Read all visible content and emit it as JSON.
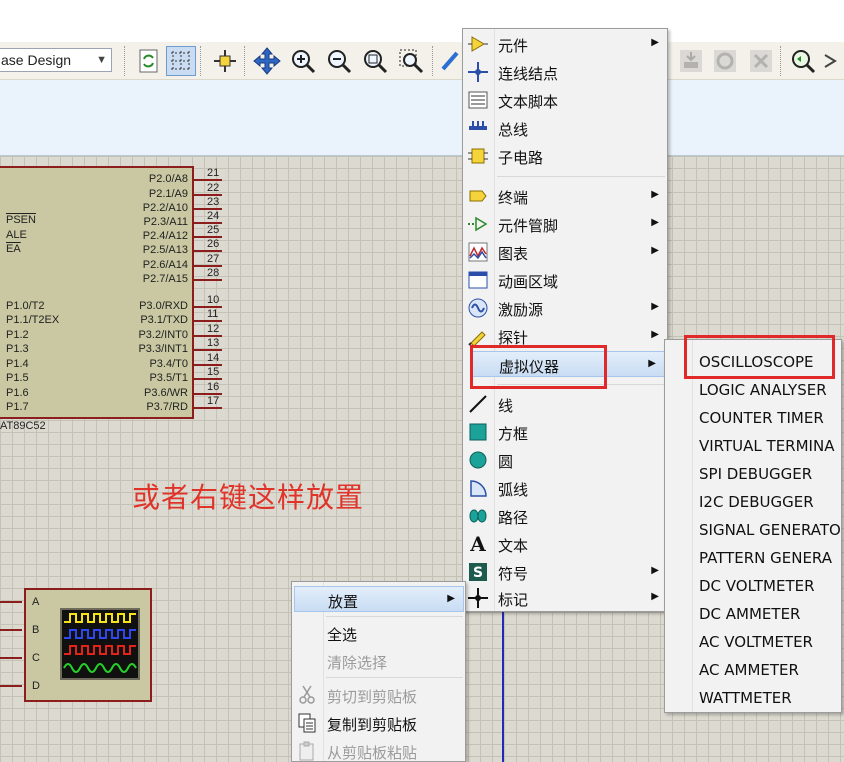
{
  "toolbar": {
    "design_mode": "ase Design",
    "icons": [
      "refresh-icon",
      "grid-icon",
      "origin-icon",
      "pan-icon",
      "zoom-in-icon",
      "zoom-out-icon",
      "zoom-all-icon",
      "zoom-area-icon",
      "wire-icon",
      "stack-icon",
      "undo-icon",
      "close-icon",
      "probe-icon",
      "forward-icon"
    ]
  },
  "chip": {
    "name": "AT89C52",
    "left_pins": [
      "PSEN",
      "ALE",
      "EA",
      "P1.0/T2",
      "P1.1/T2EX",
      "P1.2",
      "P1.3",
      "P1.4",
      "P1.5",
      "P1.6",
      "P1.7"
    ],
    "right_pins": [
      {
        "label": "P2.0/A8",
        "num": "21"
      },
      {
        "label": "P2.1/A9",
        "num": "22"
      },
      {
        "label": "P2.2/A10",
        "num": "23"
      },
      {
        "label": "P2.3/A11",
        "num": "24"
      },
      {
        "label": "P2.4/A12",
        "num": "25"
      },
      {
        "label": "P2.5/A13",
        "num": "26"
      },
      {
        "label": "P2.6/A14",
        "num": "27"
      },
      {
        "label": "P2.7/A15",
        "num": "28"
      },
      {
        "label": "P3.0/RXD",
        "num": "10"
      },
      {
        "label": "P3.1/TXD",
        "num": "11"
      },
      {
        "label": "P3.2/INT0",
        "num": "12"
      },
      {
        "label": "P3.3/INT1",
        "num": "13"
      },
      {
        "label": "P3.4/T0",
        "num": "14"
      },
      {
        "label": "P3.5/T1",
        "num": "15"
      },
      {
        "label": "P3.6/WR",
        "num": "16"
      },
      {
        "label": "P3.7/RD",
        "num": "17"
      }
    ]
  },
  "caption": "或者右键这样放置",
  "scope": {
    "channels": [
      "A",
      "B",
      "C",
      "D"
    ]
  },
  "main_menu": {
    "items": [
      {
        "label": "元件",
        "submenu": true
      },
      {
        "label": "连线结点",
        "submenu": false
      },
      {
        "label": "文本脚本",
        "submenu": false
      },
      {
        "label": "总线",
        "submenu": false
      },
      {
        "label": "子电路",
        "submenu": false
      },
      {
        "label": "终端",
        "submenu": true
      },
      {
        "label": "元件管脚",
        "submenu": true
      },
      {
        "label": "图表",
        "submenu": true
      },
      {
        "label": "动画区域",
        "submenu": false
      },
      {
        "label": "激励源",
        "submenu": true
      },
      {
        "label": "探针",
        "submenu": true
      },
      {
        "label": "虚拟仪器",
        "submenu": true
      },
      {
        "label": "线",
        "submenu": false
      },
      {
        "label": "方框",
        "submenu": false
      },
      {
        "label": "圆",
        "submenu": false
      },
      {
        "label": "弧线",
        "submenu": false
      },
      {
        "label": "路径",
        "submenu": false
      },
      {
        "label": "文本",
        "submenu": false
      },
      {
        "label": "符号",
        "submenu": true
      },
      {
        "label": "标记",
        "submenu": true
      }
    ]
  },
  "instrument_menu": {
    "items": [
      "OSCILLOSCOPE",
      "LOGIC ANALYSER",
      "COUNTER TIMER",
      "VIRTUAL TERMINA",
      "SPI DEBUGGER",
      "I2C DEBUGGER",
      "SIGNAL GENERATO",
      "PATTERN GENERA",
      "DC VOLTMETER",
      "DC AMMETER",
      "AC VOLTMETER",
      "AC AMMETER",
      "WATTMETER"
    ]
  },
  "context_menu": {
    "items": [
      {
        "label": "放置",
        "disabled": false
      },
      {
        "label": "全选",
        "disabled": false
      },
      {
        "label": "清除选择",
        "disabled": true
      },
      {
        "label": "剪切到剪贴板",
        "disabled": true
      },
      {
        "label": "复制到剪贴板",
        "disabled": false
      },
      {
        "label": "从剪贴板粘贴",
        "disabled": true
      }
    ]
  },
  "colors": {
    "accent_red": "#e02a2a",
    "wire_blue": "#2929b8",
    "chip_fill": "#c9c8a2"
  }
}
